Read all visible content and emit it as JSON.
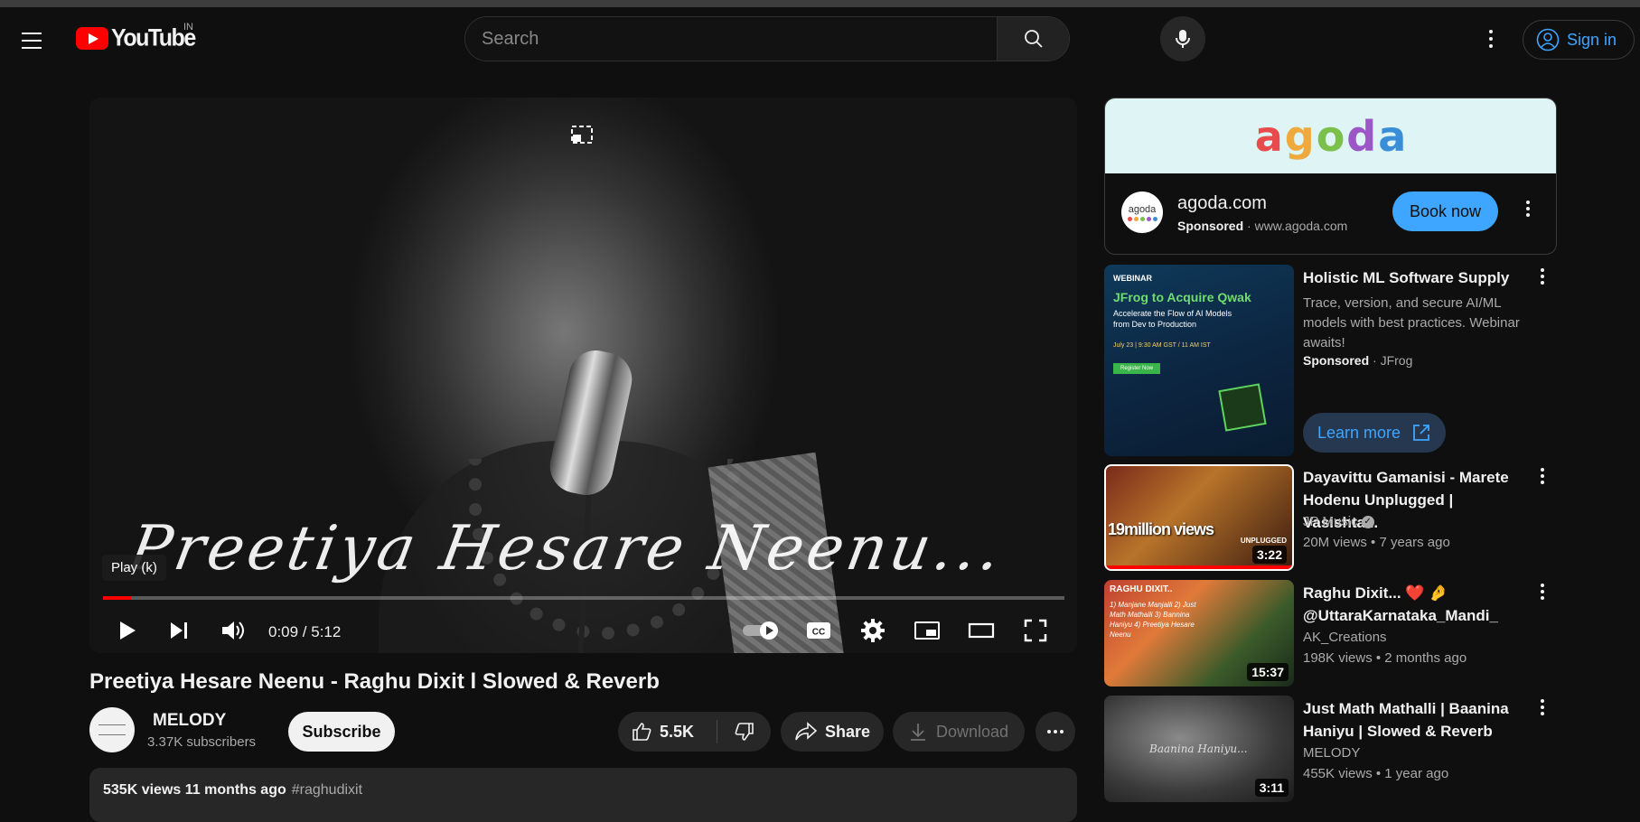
{
  "header": {
    "logo_text": "YouTube",
    "country": "IN",
    "search_placeholder": "Search",
    "signin_label": "Sign in"
  },
  "player": {
    "overlay_caption": "Preetiya Hesare Neenu...",
    "tooltip": "Play (k)",
    "time": "0:09 / 5:12",
    "progress_fraction": 0.029
  },
  "video": {
    "title": "Preetiya Hesare Neenu - Raghu Dixit l Slowed & Reverb",
    "channel_name": "MELODY",
    "subscribers": "3.37K subscribers",
    "subscribe_label": "Subscribe",
    "likes": "5.5K",
    "share_label": "Share",
    "download_label": "Download",
    "description_stats": "535K views  11 months ago",
    "description_tag": "#raghudixit"
  },
  "ad": {
    "banner_letters": [
      "a",
      "g",
      "o",
      "d",
      "a"
    ],
    "logo_text": "agoda",
    "domain": "agoda.com",
    "sponsored": "Sponsored",
    "url": "www.agoda.com",
    "cta": "Book now"
  },
  "sponsored_video": {
    "thumb_badge": "WEBINAR",
    "thumb_headline": "JFrog to Acquire Qwak",
    "thumb_sub": "Accelerate the Flow of AI Models from Dev to Production",
    "thumb_date": "July 23 | 9:30 AM GST / 11 AM IST",
    "thumb_register": "Register Now",
    "title": "Holistic ML Software Supply",
    "description": "Trace, version, and secure AI/ML models with best practices. Webinar awaits!",
    "sponsored": "Sponsored",
    "advertiser": "JFrog",
    "cta": "Learn more"
  },
  "recommendations": [
    {
      "title": "Dayavittu Gamanisi - Marete Hodenu Unplugged | Vasishta...",
      "channel": "JP Music",
      "verified": true,
      "meta": "20M views  •  7 years ago",
      "duration": "3:22",
      "thumb_text": "19million views",
      "thumb_sub": "UNPLUGGED"
    },
    {
      "title": "Raghu Dixit... ❤️ 🤌 @UttaraKarnataka_Mandi_",
      "channel": "AK_Creations",
      "verified": false,
      "meta": "198K views  •  2 months ago",
      "duration": "15:37",
      "thumb_text": "RAGHU DIXIT..",
      "thumb_sub": "1) Manjane Manjalli 2) Just Math Mathalli 3) Bannina Haniyu 4) Preetiya Hesare Neenu"
    },
    {
      "title": "Just Math Mathalli | Baanina Haniyu | Slowed & Reverb",
      "channel": "MELODY",
      "verified": false,
      "meta": "455K views  •  1 year ago",
      "duration": "3:11",
      "thumb_text": "Baanina Haniyu...",
      "thumb_sub": ""
    }
  ],
  "colors": {
    "accent_red": "#ff0000",
    "link_blue": "#3ea6ff",
    "background": "#0f0f0f"
  }
}
